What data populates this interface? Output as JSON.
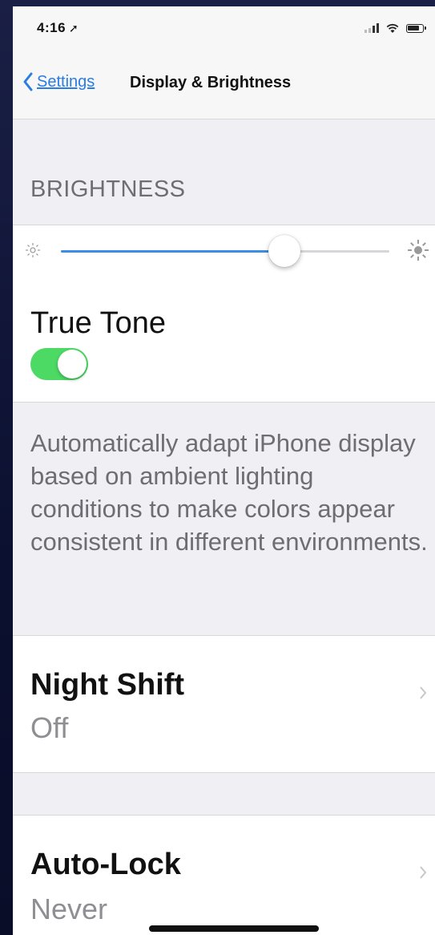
{
  "status_bar": {
    "time": "4:16",
    "location_arrow": "location-arrow-icon"
  },
  "nav": {
    "back_label": "Settings",
    "title": "Display & Brightness"
  },
  "brightness": {
    "header": "BRIGHTNESS",
    "level": 0.68
  },
  "true_tone": {
    "label": "True Tone",
    "enabled": true,
    "toggle_color": "#4cd964"
  },
  "true_tone_footer": "Automatically adapt iPhone display based on ambient lighting conditions to make colors appear consistent in different environments.",
  "night_shift": {
    "title": "Night Shift",
    "value": "Off"
  },
  "auto_lock": {
    "title": "Auto-Lock",
    "value": "Never"
  },
  "colors": {
    "accent": "#2a7de1",
    "slider_fill": "#3a8ee6",
    "background": "#efeff4"
  }
}
